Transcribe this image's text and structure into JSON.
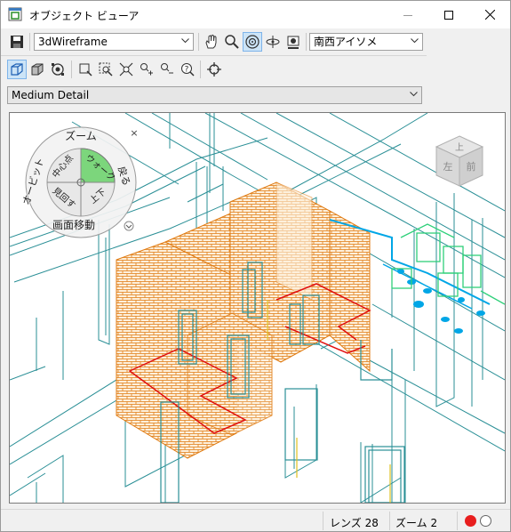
{
  "window": {
    "title": "オブジェクト ビューア"
  },
  "toolbar1": {
    "save_icon": "save-icon",
    "visual_style": "3dWireframe",
    "view_preset": "南西アイソメ",
    "tools": [
      "pan-icon",
      "zoom-icon",
      "orbit-icon",
      "walk-icon",
      "camera-icon"
    ]
  },
  "toolbar2": {
    "tools": [
      "view-cube-icon",
      "solid-box-icon",
      "navigation-wheel-icon",
      "zoom-window-icon",
      "zoom-object-icon",
      "zoom-extents-icon",
      "zoom-in-icon",
      "zoom-out-icon",
      "zoom-help-icon",
      "locate-icon"
    ]
  },
  "detail": {
    "level": "Medium Detail"
  },
  "nav_wheel": {
    "zoom": "ズーム",
    "orbit": "オービット",
    "center": "中心点",
    "walk": "ウォーク",
    "rewind": "戻る",
    "look": "見回す",
    "updown": "上下",
    "pan": "画面移動",
    "close": "×"
  },
  "viewcube": {
    "top": "上",
    "left": "左",
    "front": "前"
  },
  "status": {
    "lens": "レンズ 28",
    "zoom": "ズーム 2"
  },
  "colors": {
    "brick": "#e07a10",
    "teal": "#2a8f96",
    "cyan": "#00a6e6",
    "green": "#2fd07a",
    "red": "#e01010",
    "wheel_green": "#7cd67c"
  }
}
